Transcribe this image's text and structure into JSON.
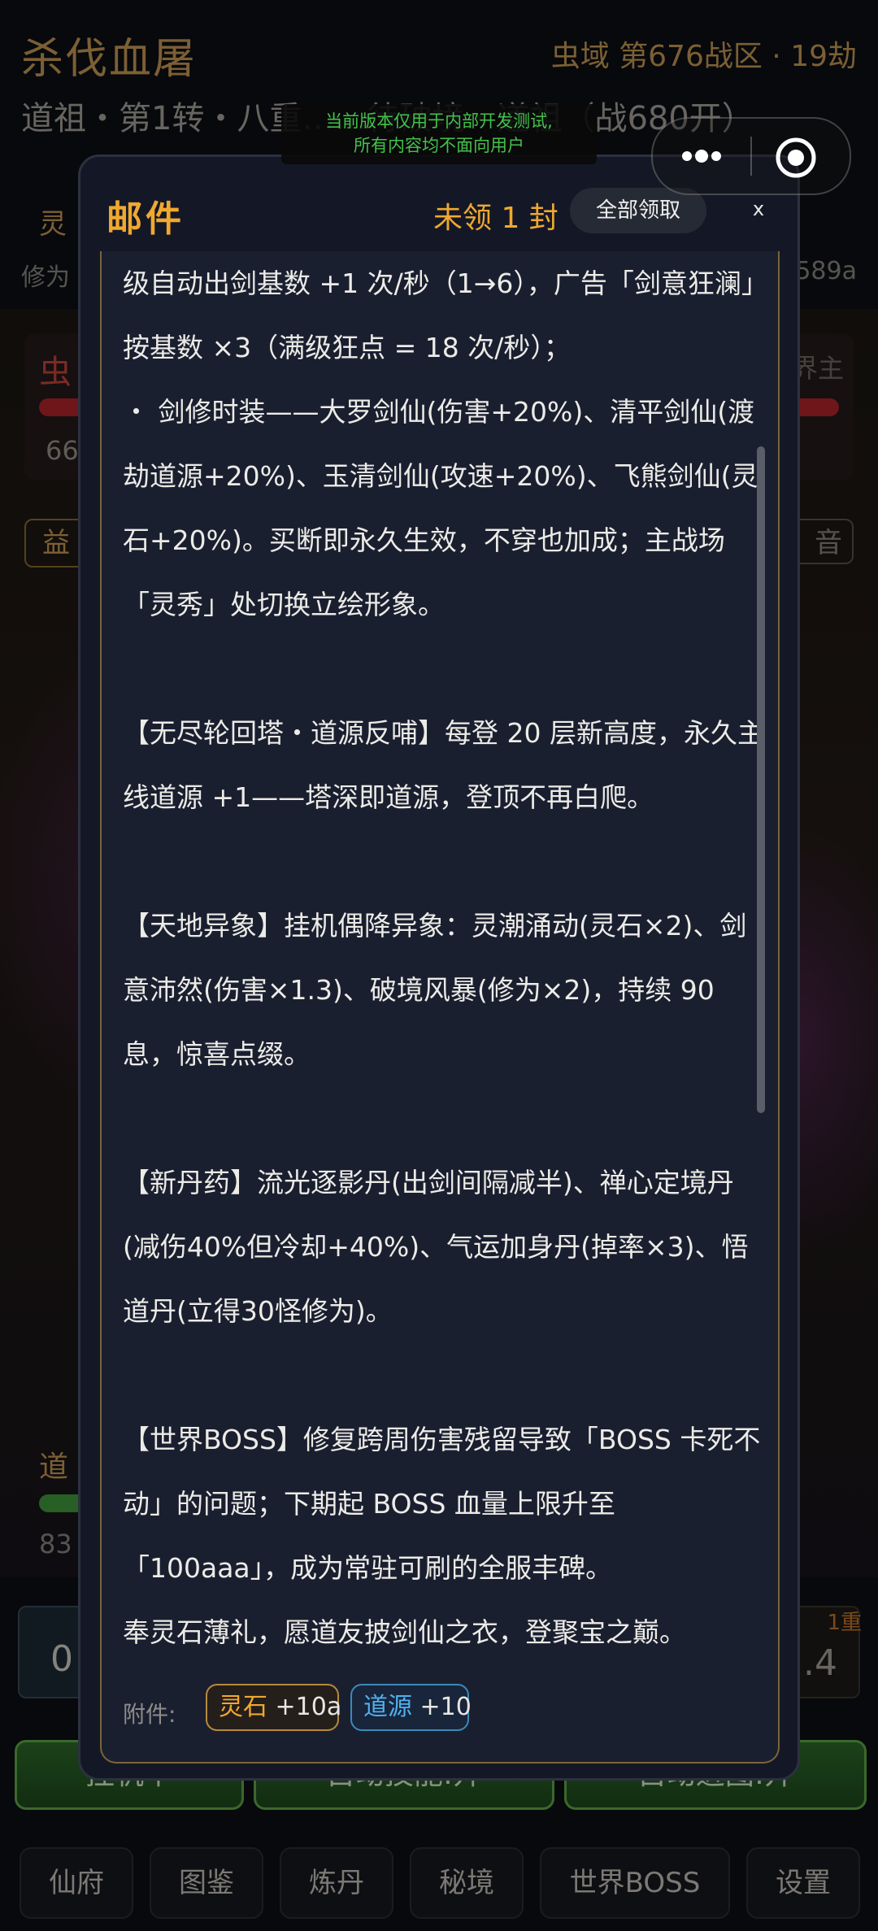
{
  "game": {
    "title": "杀伐血屠",
    "zone": "虫域 第676战区 · 19劫",
    "status_line": "道祖・第1转・八重……待破境・道祖（战680开）",
    "sub_label": "灵",
    "cultivation_label": "修为",
    "cultivation_value": "589a",
    "left_enemy": "虫",
    "left_hp": "66",
    "right_enemy": "界主",
    "tag_left": "益",
    "tag_right": "音",
    "dao_label": "道",
    "dao_value": "83",
    "skill_left_num": "0",
    "skill_right_num": ".4",
    "skill_right_tag": "1重",
    "buttons": [
      "挂机中",
      "自动技能:开",
      "自动进图:开"
    ],
    "nav": [
      "仙府",
      "图鉴",
      "炼丹",
      "秘境",
      "世界BOSS",
      "设置"
    ]
  },
  "dev_notice": {
    "line1": "当前版本仅用于内部开发测试,",
    "line2": "所有内容均不面向用户"
  },
  "capsule": {
    "more_icon": "more-dots-icon",
    "close_icon": "target-icon"
  },
  "mail": {
    "title": "邮件",
    "unread": "未领 1 封",
    "claim_all": "全部领取",
    "close": "x",
    "paragraphs": [
      "级自动出剑基数 +1 次/秒（1→6），广告「剑意狂澜」按基数 ×3（满级狂点 = 18 次/秒）；",
      "・ 剑修时装——大罗剑仙(伤害+20%)、清平剑仙(渡劫道源+20%)、玉清剑仙(攻速+20%)、飞熊剑仙(灵石+20%)。买断即永久生效，不穿也加成；主战场「灵秀」处切换立绘形象。",
      "",
      "【无尽轮回塔・道源反哺】每登 20 层新高度，永久主线道源 +1——塔深即道源，登顶不再白爬。",
      "",
      "【天地异象】挂机偶降异象：灵潮涌动(灵石×2)、剑意沛然(伤害×1.3)、破境风暴(修为×2)，持续 90 息，惊喜点缀。",
      "",
      "【新丹药】流光逐影丹(出剑间隔减半)、禅心定境丹(减伤40%但冷却+40%)、气运加身丹(掉率×3)、悟道丹(立得30怪修为)。",
      "",
      "【世界BOSS】修复跨周伤害残留导致「BOSS 卡死不动」的问题；下期起 BOSS 血量上限升至「100aaa」，成为常驻可刷的全服丰碑。",
      "奉灵石薄礼，愿道友披剑仙之衣，登聚宝之巅。"
    ],
    "attachments_label": "附件:",
    "attachments": [
      {
        "name": "灵石",
        "amount": "+10a",
        "color": "#f0a830"
      },
      {
        "name": "道源",
        "amount": "+10",
        "color": "#4fb0f0"
      }
    ]
  }
}
